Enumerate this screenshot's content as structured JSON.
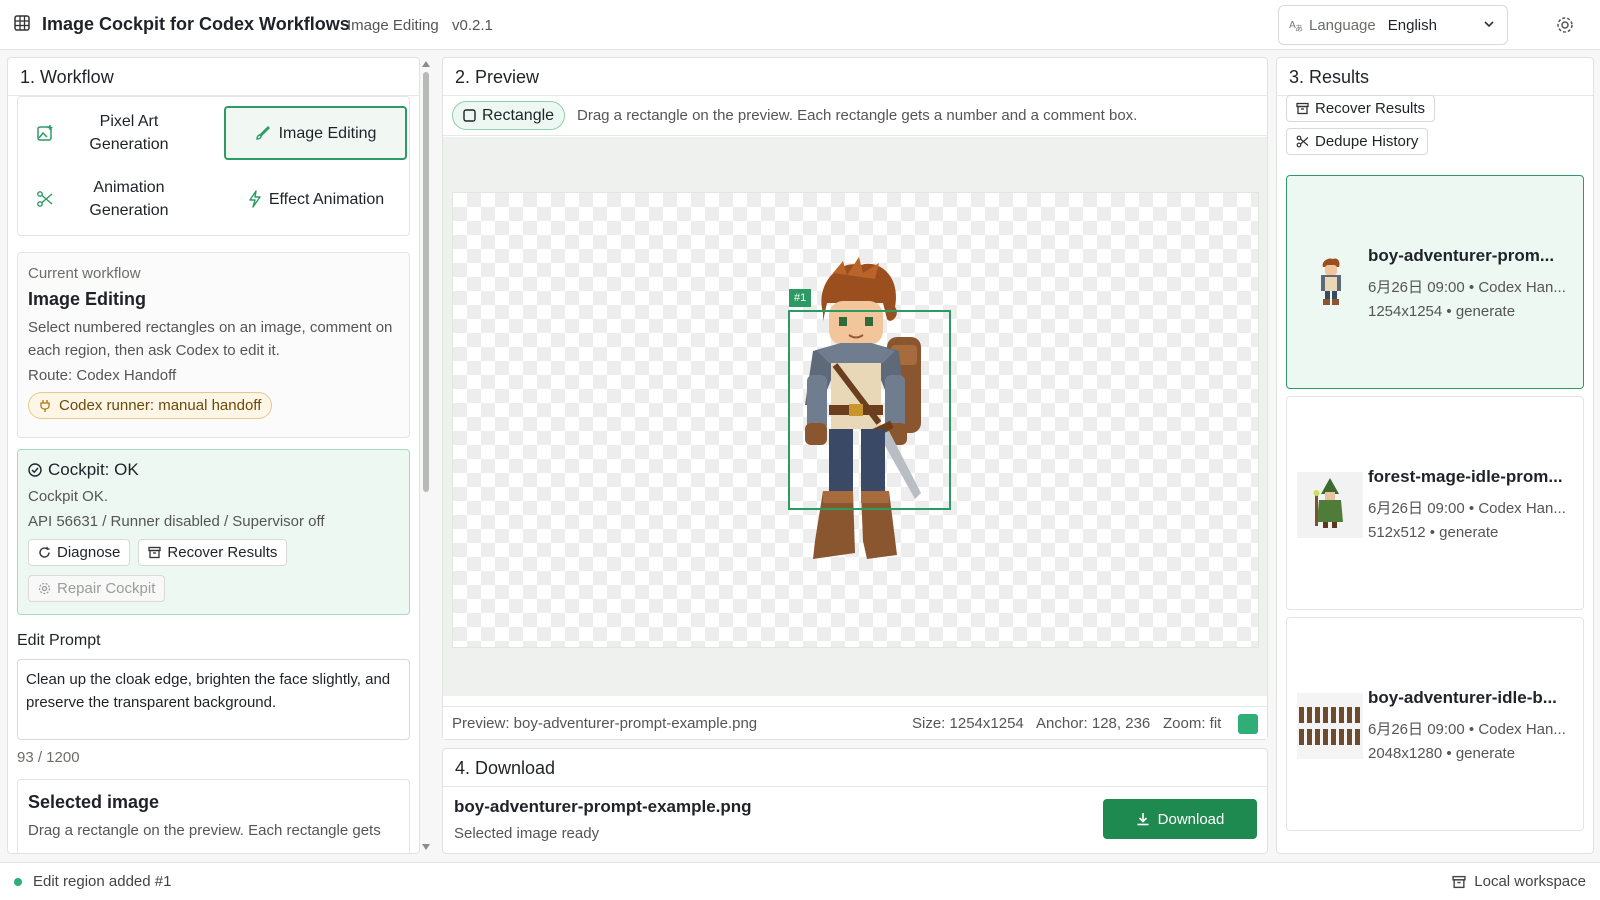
{
  "header": {
    "title": "Image Cockpit for Codex Workflows",
    "subtitle": "Image Editing",
    "version": "v0.2.1",
    "language_label": "Language",
    "language_value": "English"
  },
  "workflow": {
    "panel_title": "1. Workflow",
    "buttons": [
      {
        "label": "Pixel Art\nGeneration",
        "icon": "image-plus-icon",
        "selected": false
      },
      {
        "label": "Image Editing",
        "icon": "brush-icon",
        "selected": true
      },
      {
        "label": "Animation\nGeneration",
        "icon": "scissors-icon",
        "selected": false
      },
      {
        "label": "Effect Animation",
        "icon": "bolt-icon",
        "selected": false
      }
    ],
    "current_label": "Current workflow",
    "current_title": "Image Editing",
    "current_desc": "Select numbered rectangles on an image, comment on each region, then ask Codex to edit it.",
    "route": "Route: Codex Handoff",
    "runner_pill": "Codex runner: manual handoff",
    "cockpit": {
      "title": "Cockpit: OK",
      "line1": "Cockpit OK.",
      "line2": "API 56631 / Runner disabled / Supervisor off",
      "diagnose": "Diagnose",
      "recover": "Recover Results",
      "repair": "Repair Cockpit"
    },
    "edit_prompt_label": "Edit Prompt",
    "edit_prompt_value": "Clean up the cloak edge, brighten the face slightly, and preserve the transparent background.",
    "edit_count": "93 / 1200",
    "selected_image_title": "Selected image",
    "selected_image_desc": "Drag a rectangle on the preview. Each rectangle gets"
  },
  "preview": {
    "panel_title": "2. Preview",
    "tool_label": "Rectangle",
    "tool_hint": "Drag a rectangle on the preview. Each rectangle gets a number and a comment box.",
    "region_tag": "#1",
    "filename": "Preview: boy-adventurer-prompt-example.png",
    "size": "Size: 1254x1254",
    "anchor": "Anchor: 128, 236",
    "zoom": "Zoom: fit",
    "swatch_color": "#2fae78"
  },
  "download": {
    "panel_title": "4. Download",
    "filename": "boy-adventurer-prompt-example.png",
    "status": "Selected image ready",
    "button": "Download"
  },
  "results": {
    "panel_title": "3. Results",
    "recover": "Recover Results",
    "dedupe": "Dedupe History",
    "items": [
      {
        "name": "boy-adventurer-prom...",
        "meta": "6月26日 09:00 • Codex Han...",
        "size": "1254x1254 • generate",
        "selected": true
      },
      {
        "name": "forest-mage-idle-prom...",
        "meta": "6月26日 09:00 • Codex Han...",
        "size": "512x512 • generate",
        "selected": false
      },
      {
        "name": "boy-adventurer-idle-b...",
        "meta": "6月26日 09:00 • Codex Han...",
        "size": "2048x1280 • generate",
        "selected": false
      }
    ]
  },
  "footer": {
    "message": "Edit region added #1",
    "workspace": "Local workspace"
  },
  "colors": {
    "accent": "#2c9a63",
    "download_button": "#1f8a4f",
    "runner_pill_bg": "#fdf6e6"
  }
}
